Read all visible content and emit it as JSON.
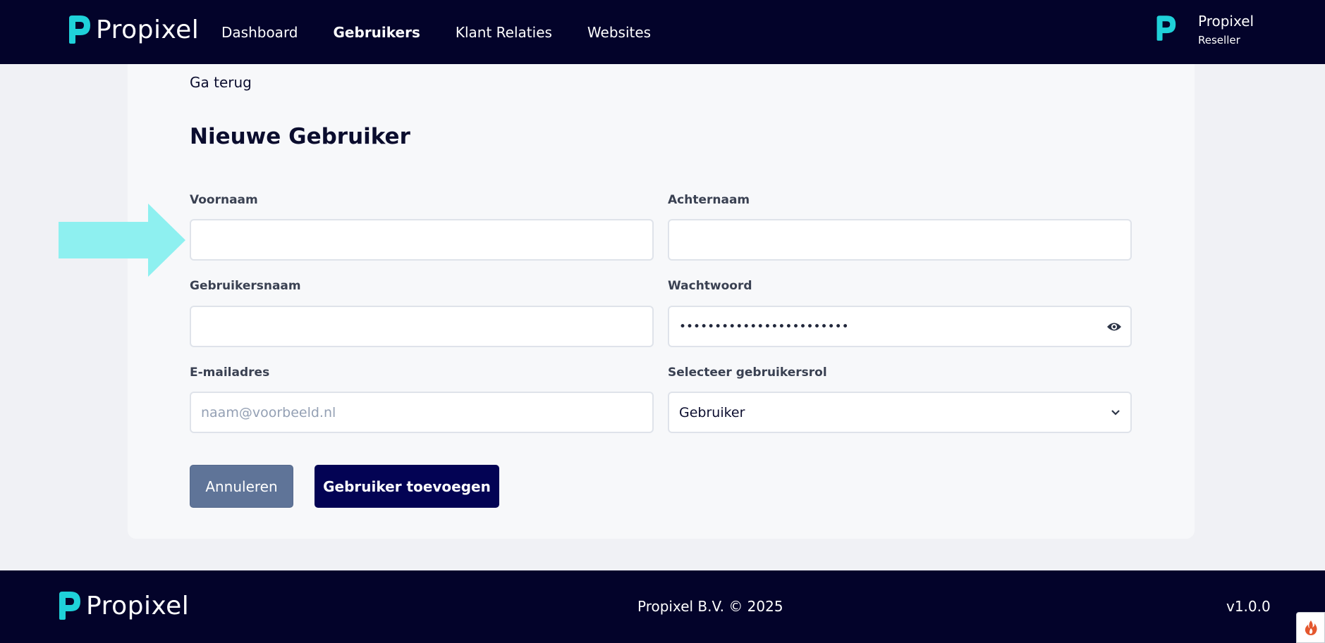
{
  "brand": {
    "name": "Propixel",
    "accent": "#1fd1d9",
    "navy": "#03032a"
  },
  "header": {
    "nav": [
      "Dashboard",
      "Gebruikers",
      "Klant Relaties",
      "Websites"
    ],
    "active": "Gebruikers",
    "user": {
      "name": "Propixel",
      "role": "Reseller"
    }
  },
  "form": {
    "back_label": "Ga terug",
    "title": "Nieuwe Gebruiker",
    "first_name": {
      "label": "Voornaam",
      "value": ""
    },
    "last_name": {
      "label": "Achternaam",
      "value": ""
    },
    "username": {
      "label": "Gebruikersnaam",
      "value": ""
    },
    "password": {
      "label": "Wachtwoord",
      "value": "••••••••••••••••••••••••"
    },
    "email": {
      "label": "E-mailadres",
      "placeholder": "naam@voorbeeld.nl"
    },
    "role": {
      "label": "Selecteer gebruikersrol",
      "selected": "Gebruiker"
    },
    "cancel_label": "Annuleren",
    "submit_label": "Gebruiker toevoegen"
  },
  "footer": {
    "copyright": "Propixel B.V. © 2025",
    "version": "v1.0.0"
  },
  "icons": {
    "logo": "propixel-p-logo-icon",
    "eye": "eye-icon",
    "chevron": "chevron-down-icon",
    "arrow": "pointer-arrow-icon",
    "widget": "flame-icon"
  }
}
